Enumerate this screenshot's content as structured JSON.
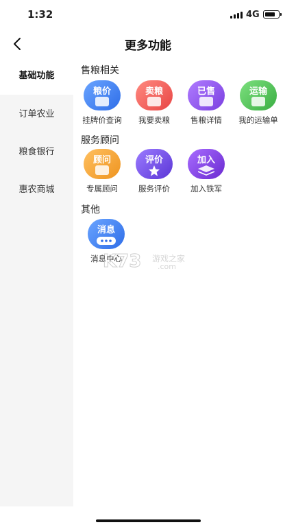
{
  "status": {
    "time": "1:32",
    "network": "4G",
    "battery_level": 0.8
  },
  "nav": {
    "title": "更多功能"
  },
  "sidebar": {
    "items": [
      {
        "label": "基础功能",
        "active": true
      },
      {
        "label": "订单农业",
        "active": false
      },
      {
        "label": "粮食银行",
        "active": false
      },
      {
        "label": "惠农商城",
        "active": false
      }
    ]
  },
  "sections": [
    {
      "title": "售粮相关",
      "items": [
        {
          "badge": "粮价",
          "label": "挂牌价查询",
          "icon": "price-tag-icon",
          "color": "#3f7ff0"
        },
        {
          "badge": "卖粮",
          "label": "我要卖粮",
          "icon": "grain-bag-icon",
          "color": "#f05a5a"
        },
        {
          "badge": "已售",
          "label": "售粮详情",
          "icon": "document-icon",
          "color": "#8a4fe6"
        },
        {
          "badge": "运输",
          "label": "我的运输单",
          "icon": "truck-icon",
          "color": "#4cbf53"
        }
      ]
    },
    {
      "title": "服务顾问",
      "items": [
        {
          "badge": "顾问",
          "label": "专属顾问",
          "icon": "consultant-icon",
          "color": "#f0a030"
        },
        {
          "badge": "评价",
          "label": "服务评价",
          "icon": "star-rating-icon",
          "color": "#6a43e0"
        },
        {
          "badge": "加入",
          "label": "加入铁军",
          "icon": "layers-icon",
          "color": "#7a35d8"
        }
      ]
    },
    {
      "title": "其他",
      "items": [
        {
          "badge": "消息",
          "label": "消息中心",
          "icon": "chat-bubble-icon",
          "color": "#3f7ff0"
        }
      ]
    }
  ],
  "watermark": {
    "brand": "K73",
    "text": "游戏之家",
    "domain": ".com"
  }
}
